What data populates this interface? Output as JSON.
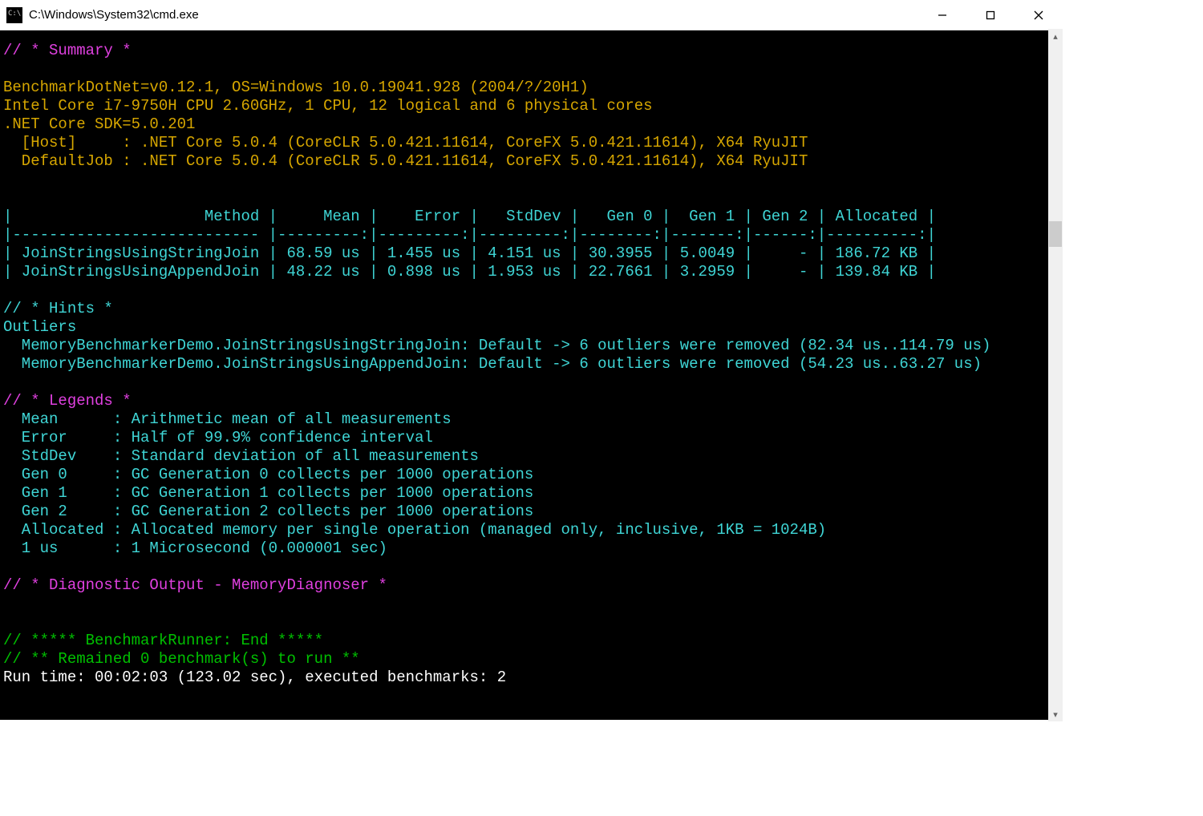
{
  "titlebar": {
    "title": "C:\\Windows\\System32\\cmd.exe"
  },
  "summary_header": "// * Summary *",
  "env_lines": [
    "BenchmarkDotNet=v0.12.1, OS=Windows 10.0.19041.928 (2004/?/20H1)",
    "Intel Core i7-9750H CPU 2.60GHz, 1 CPU, 12 logical and 6 physical cores",
    ".NET Core SDK=5.0.201",
    "  [Host]     : .NET Core 5.0.4 (CoreCLR 5.0.421.11614, CoreFX 5.0.421.11614), X64 RyuJIT",
    "  DefaultJob : .NET Core 5.0.4 (CoreCLR 5.0.421.11614, CoreFX 5.0.421.11614), X64 RyuJIT"
  ],
  "table_header": "|                     Method |     Mean |    Error |   StdDev |   Gen 0 |  Gen 1 | Gen 2 | Allocated |",
  "table_sep": "|--------------------------- |---------:|---------:|---------:|--------:|-------:|------:|----------:|",
  "table_rows": [
    "| JoinStringsUsingStringJoin | 68.59 us | 1.455 us | 4.151 us | 30.3955 | 5.0049 |     - | 186.72 KB |",
    "| JoinStringsUsingAppendJoin | 48.22 us | 0.898 us | 1.953 us | 22.7661 | 3.2959 |     - | 139.84 KB |"
  ],
  "hints_header": "// * Hints *",
  "outliers_label": "Outliers",
  "outliers": [
    "  MemoryBenchmarkerDemo.JoinStringsUsingStringJoin: Default -> 6 outliers were removed (82.34 us..114.79 us)",
    "  MemoryBenchmarkerDemo.JoinStringsUsingAppendJoin: Default -> 6 outliers were removed (54.23 us..63.27 us)"
  ],
  "legends_header": "// * Legends *",
  "legends": [
    "  Mean      : Arithmetic mean of all measurements",
    "  Error     : Half of 99.9% confidence interval",
    "  StdDev    : Standard deviation of all measurements",
    "  Gen 0     : GC Generation 0 collects per 1000 operations",
    "  Gen 1     : GC Generation 1 collects per 1000 operations",
    "  Gen 2     : GC Generation 2 collects per 1000 operations",
    "  Allocated : Allocated memory per single operation (managed only, inclusive, 1KB = 1024B)",
    "  1 us      : 1 Microsecond (0.000001 sec)"
  ],
  "diagnostic_header": "// * Diagnostic Output - MemoryDiagnoser *",
  "runner_end": "// ***** BenchmarkRunner: End *****",
  "remained": "// ** Remained 0 benchmark(s) to run **",
  "runtime": "Run time: 00:02:03 (123.02 sec), executed benchmarks: 2",
  "chart_data": {
    "type": "table",
    "columns": [
      "Method",
      "Mean",
      "Error",
      "StdDev",
      "Gen 0",
      "Gen 1",
      "Gen 2",
      "Allocated"
    ],
    "rows": [
      {
        "Method": "JoinStringsUsingStringJoin",
        "Mean": "68.59 us",
        "Error": "1.455 us",
        "StdDev": "4.151 us",
        "Gen 0": 30.3955,
        "Gen 1": 5.0049,
        "Gen 2": "-",
        "Allocated": "186.72 KB"
      },
      {
        "Method": "JoinStringsUsingAppendJoin",
        "Mean": "48.22 us",
        "Error": "0.898 us",
        "StdDev": "1.953 us",
        "Gen 0": 22.7661,
        "Gen 1": 3.2959,
        "Gen 2": "-",
        "Allocated": "139.84 KB"
      }
    ]
  }
}
